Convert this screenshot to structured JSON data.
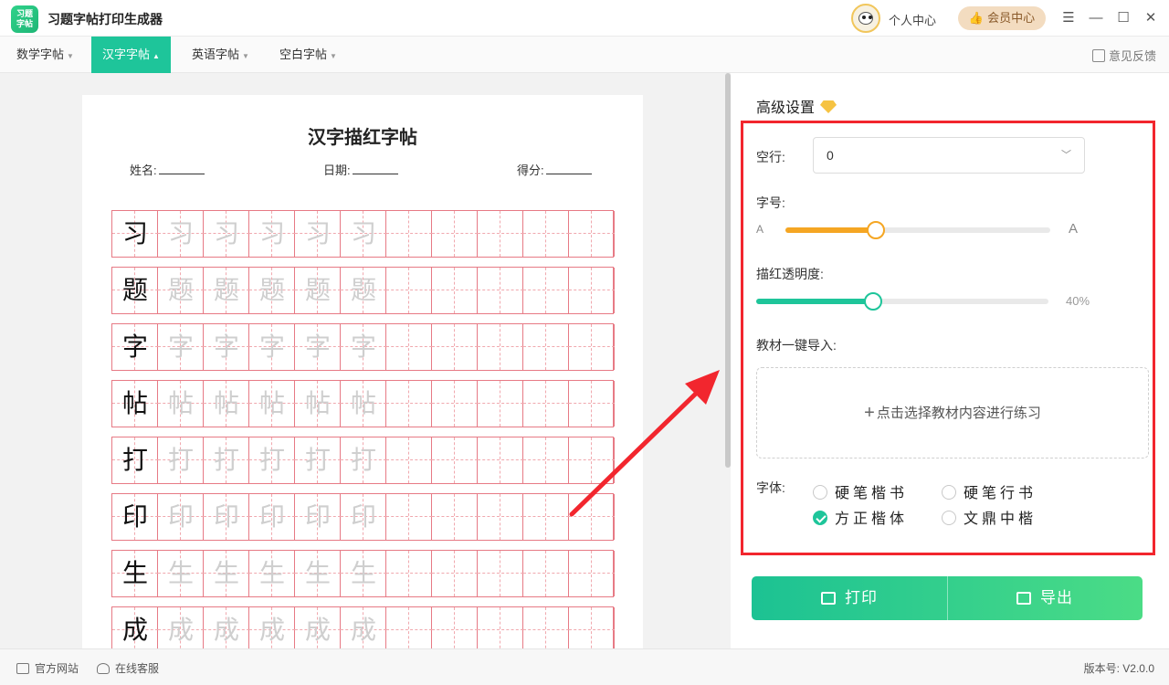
{
  "app": {
    "logo_top": "习题",
    "logo_bottom": "字帖",
    "title": "习题字帖打印生成器",
    "personal_center": "个人中心",
    "vip_center": "会员中心",
    "controls": {
      "menu": "☰",
      "minimize": "—",
      "maximize": "☐",
      "close": "✕"
    }
  },
  "tabs": [
    {
      "label": "数学字帖",
      "active": false
    },
    {
      "label": "汉字字帖",
      "active": true
    },
    {
      "label": "英语字帖",
      "active": false
    },
    {
      "label": "空白字帖",
      "active": false
    }
  ],
  "feedback": "意见反馈",
  "sheet": {
    "title": "汉字描红字帖",
    "name_label": "姓名:",
    "date_label": "日期:",
    "score_label": "得分:",
    "characters": [
      "习",
      "题",
      "字",
      "帖",
      "打",
      "印",
      "生",
      "成"
    ],
    "trace_count": 5,
    "columns": 11
  },
  "settings": {
    "title": "高级设置",
    "blank_rows_label": "空行:",
    "blank_rows_value": "0",
    "font_size_label": "字号:",
    "font_size_small": "A",
    "font_size_large": "A",
    "font_size_level": 0.34,
    "opacity_label": "描红透明度:",
    "opacity_value": "40%",
    "opacity_level": 0.4,
    "import_label": "教材一键导入:",
    "import_button": "点击选择教材内容进行练习",
    "font_label": "字体:",
    "fonts": [
      {
        "label": "硬笔楷书",
        "selected": false
      },
      {
        "label": "硬笔行书",
        "selected": false
      },
      {
        "label": "方正楷体",
        "selected": true
      },
      {
        "label": "文鼎中楷",
        "selected": false
      }
    ]
  },
  "actions": {
    "print": "打印",
    "export": "导出"
  },
  "footer": {
    "website": "官方网站",
    "support": "在线客服",
    "version": "版本号: V2.0.0"
  },
  "colors": {
    "accent": "#1ec59a",
    "highlight": "#f2262e",
    "slider_orange": "#f5a623",
    "grid_red": "#e77a85"
  }
}
